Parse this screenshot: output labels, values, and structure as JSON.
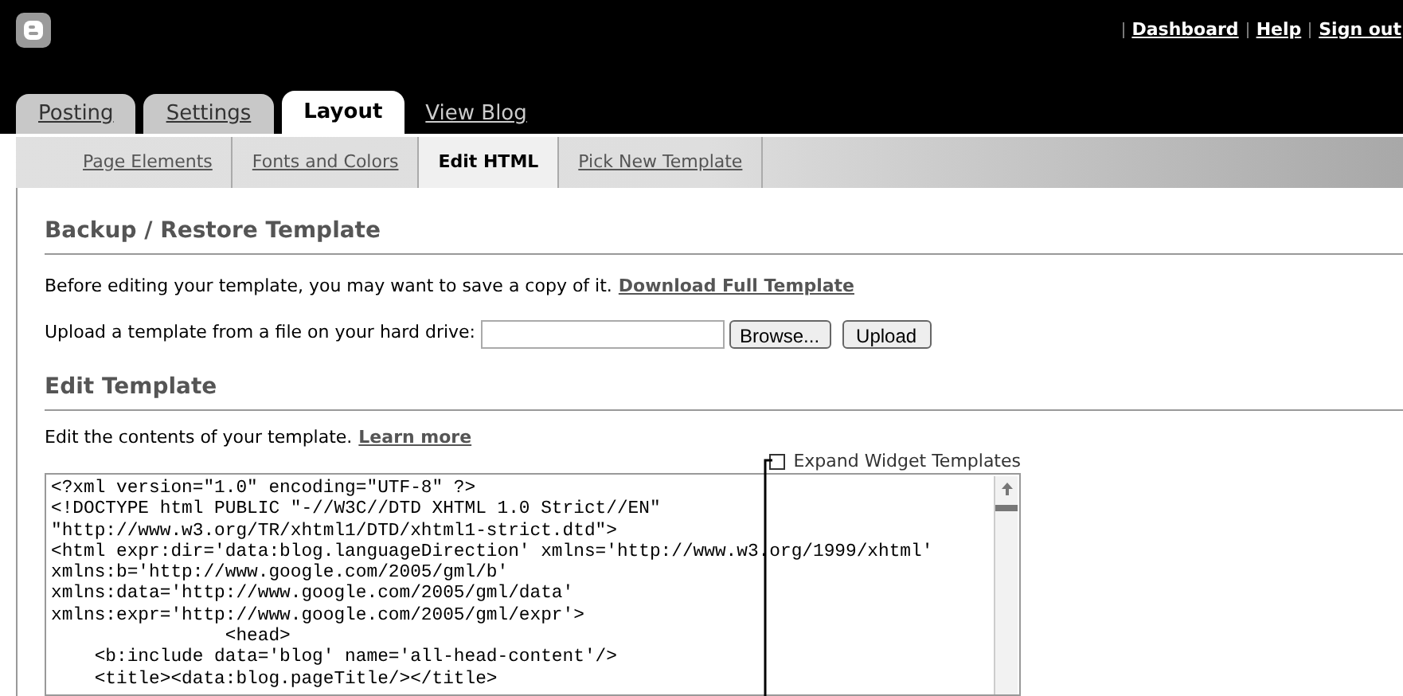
{
  "header": {
    "links": [
      "Dashboard",
      "Help",
      "Sign out"
    ]
  },
  "tabs": [
    {
      "label": "Posting",
      "selected": false
    },
    {
      "label": "Settings",
      "selected": false
    },
    {
      "label": "Layout",
      "selected": true
    }
  ],
  "view_blog_link": "View Blog",
  "subtabs": [
    {
      "label": "Page Elements",
      "selected": false
    },
    {
      "label": "Fonts and Colors",
      "selected": false
    },
    {
      "label": "Edit HTML",
      "selected": true
    },
    {
      "label": "Pick New Template",
      "selected": false
    }
  ],
  "backup": {
    "heading": "Backup / Restore Template",
    "intro": "Before editing your template, you may want to save a copy of it.",
    "link": "Download Full Template",
    "upload_label": "Upload a template from a file on your hard drive:",
    "browse_button": "Browse...",
    "upload_button": "Upload"
  },
  "edit": {
    "heading": "Edit Template",
    "intro": "Edit the contents of your template.",
    "link": "Learn more",
    "expand_widgets": {
      "label": "Expand Widget Templates",
      "checked": false
    },
    "code_lines": [
      "<?xml version=\"1.0\" encoding=\"UTF-8\" ?>",
      "<!DOCTYPE html PUBLIC \"-//W3C//DTD XHTML 1.0 Strict//EN\"",
      "\"http://www.w3.org/TR/xhtml1/DTD/xhtml1-strict.dtd\">",
      "<html expr:dir='data:blog.languageDirection' xmlns='http://www.w3.org/1999/xhtml'",
      "xmlns:b='http://www.google.com/2005/gml/b'",
      "xmlns:data='http://www.google.com/2005/gml/data'",
      "xmlns:expr='http://www.google.com/2005/gml/expr'>",
      "                <head>",
      "    <b:include data='blog' name='all-head-content'/>",
      "    <title><data:blog.pageTitle/></title>"
    ]
  }
}
